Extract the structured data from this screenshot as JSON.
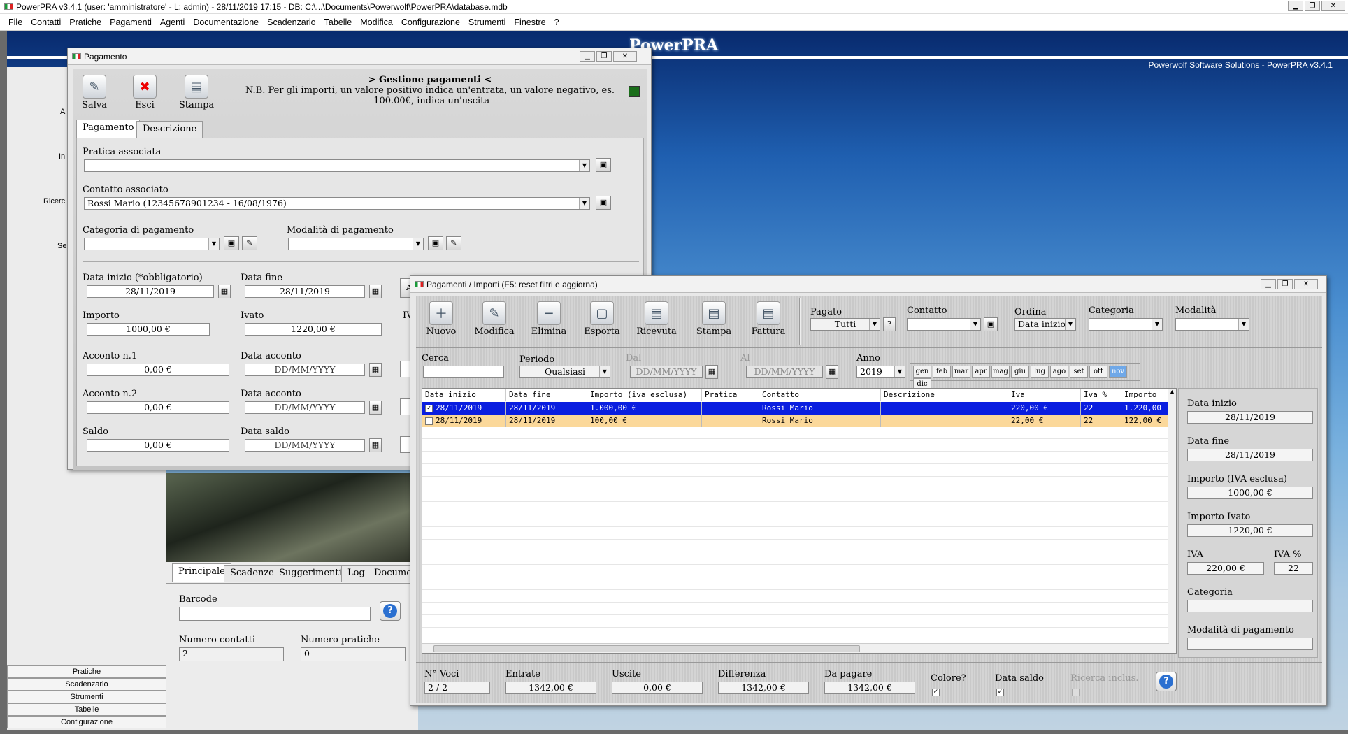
{
  "app": {
    "title": "PowerPRA v3.4.1  (user: 'amministratore'  - L: admin) - 28/11/2019 17:15 - DB: C:\\...\\Documents\\Powerwolf\\PowerPRA\\database.mdb",
    "brand": "PowerPRA",
    "solutions": "Powerwolf Software Solutions - PowerPRA v3.4.1"
  },
  "menu": [
    "File",
    "Contatti",
    "Pratiche",
    "Pagamenti",
    "Agenti",
    "Documentazione",
    "Scadenzario",
    "Tabelle",
    "Modifica",
    "Configurazione",
    "Strumenti",
    "Finestre",
    "?"
  ],
  "left": {
    "nav": [
      "Pratiche",
      "Scadenzario",
      "Strumenti",
      "Tabelle",
      "Configurazione"
    ],
    "frag": [
      "A",
      "In",
      "Ricerc",
      "Se"
    ]
  },
  "lower": {
    "tabs": [
      "Principale",
      "Scadenze",
      "Suggerimenti",
      "Log",
      "Docume"
    ],
    "barcode_label": "Barcode",
    "barcode_value": "",
    "num_contatti_label": "Numero contatti",
    "num_contatti": "2",
    "num_pratiche_label": "Numero pratiche",
    "num_pratiche": "0"
  },
  "pag": {
    "title": "Pagamento",
    "toolbar": {
      "save": "Salva",
      "exit": "Esci",
      "print": "Stampa"
    },
    "header": "> Gestione pagamenti <",
    "note": "N.B. Per gli importi, un valore positivo indica un'entrata, un valore negativo, es. -100.00€, indica un'uscita",
    "tabs": [
      "Pagamento",
      "Descrizione"
    ],
    "pratica_label": "Pratica associata",
    "pratica_value": "",
    "contatto_label": "Contatto associato",
    "contatto_value": "Rossi Mario (12345678901234 - 16/08/1976)",
    "categoria_label": "Categoria di pagamento",
    "categoria_value": "",
    "modalita_label": "Modalità di pagamento",
    "modalita_value": "",
    "data_inizio_label": "Data inizio (*obbligatorio)",
    "data_inizio": "28/11/2019",
    "data_fine_label": "Data fine",
    "data_fine": "28/11/2019",
    "importo_label": "Importo",
    "importo": "1000,00 €",
    "ivato_label": "Ivato",
    "ivato": "1220,00 €",
    "iva_frag": "IVA",
    "a_frag": "A",
    "acc1_label": "Acconto n.1",
    "acc1": "0,00 €",
    "acc_date_label": "Data acconto",
    "acc_date_ph": "DD/MM/YYYY",
    "acc2_label": "Acconto n.2",
    "acc2": "0,00 €",
    "saldo_label": "Saldo",
    "saldo": "0,00 €",
    "saldo_date_label": "Data saldo",
    "saldo_date_ph": "DD/MM/YYYY"
  },
  "list": {
    "title": "Pagamenti / Importi  (F5: reset filtri e aggiorna)",
    "toolbar": [
      "Nuovo",
      "Modifica",
      "Elimina",
      "Esporta",
      "Ricevuta",
      "Stampa",
      "Fattura"
    ],
    "filters": {
      "pagato_label": "Pagato",
      "pagato": "Tutti",
      "contatto_label": "Contatto",
      "contatto": "",
      "ordina_label": "Ordina",
      "ordina": "Data inizio",
      "categoria_label": "Categoria",
      "categoria": "",
      "modalita_label": "Modalità",
      "modalita": "",
      "cerca_label": "Cerca",
      "cerca": "",
      "periodo_label": "Periodo",
      "periodo": "Qualsiasi",
      "dal_label": "Dal",
      "dal": "DD/MM/YYYY",
      "al_label": "Al",
      "al": "DD/MM/YYYY",
      "anno_label": "Anno",
      "anno": "2019",
      "q": "?"
    },
    "months": [
      "gen",
      "feb",
      "mar",
      "apr",
      "mag",
      "giu",
      "lug",
      "ago",
      "set",
      "ott",
      "nov",
      "dic"
    ],
    "active_month": "nov",
    "columns": [
      "Data inizio",
      "Data fine",
      "Importo (iva esclusa)",
      "Pratica",
      "Contatto",
      "Descrizione",
      "Iva",
      "Iva %",
      "Importo"
    ],
    "rows": [
      [
        "28/11/2019",
        "28/11/2019",
        "1.000,00 €",
        "",
        "Rossi Mario",
        "",
        "220,00 €",
        "22",
        "1.220,00"
      ],
      [
        "28/11/2019",
        "28/11/2019",
        "100,00 €",
        "",
        "Rossi Mario",
        "",
        "22,00 €",
        "22",
        "122,00 €"
      ]
    ],
    "detail": {
      "di_label": "Data inizio",
      "di": "28/11/2019",
      "df_label": "Data fine",
      "df": "28/11/2019",
      "imp_label": "Importo (IVA esclusa)",
      "imp": "1000,00 €",
      "ivato_label": "Importo Ivato",
      "ivato": "1220,00 €",
      "iva_label": "IVA",
      "iva": "220,00 €",
      "ivap_label": "IVA %",
      "ivap": "22",
      "cat_label": "Categoria",
      "cat": "",
      "mod_label": "Modalità di pagamento",
      "mod": ""
    },
    "footer": {
      "voci_label": "N° Voci",
      "voci": "2 / 2",
      "entrate_label": "Entrate",
      "entrate": "1342,00 €",
      "uscite_label": "Uscite",
      "uscite": "0,00 €",
      "diff_label": "Differenza",
      "diff": "1342,00 €",
      "dapagare_label": "Da pagare",
      "dapagare": "1342,00 €",
      "colore_label": "Colore?",
      "datasaldo_label": "Data saldo",
      "ricerca_label": "Ricerca inclus."
    }
  }
}
